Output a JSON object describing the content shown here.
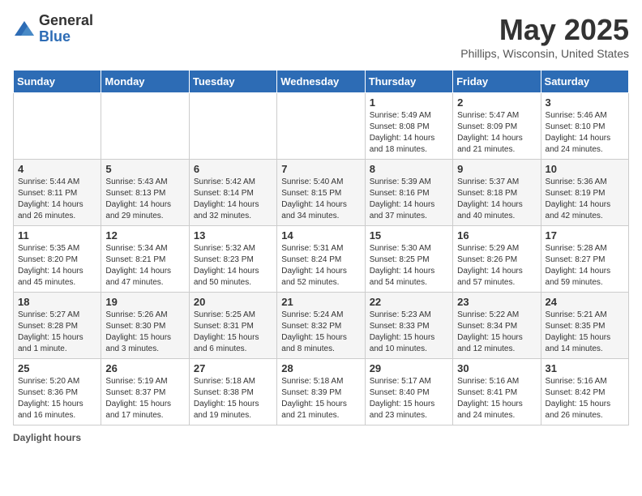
{
  "header": {
    "logo_general": "General",
    "logo_blue": "Blue",
    "month_title": "May 2025",
    "location": "Phillips, Wisconsin, United States"
  },
  "days_of_week": [
    "Sunday",
    "Monday",
    "Tuesday",
    "Wednesday",
    "Thursday",
    "Friday",
    "Saturday"
  ],
  "weeks": [
    [
      {
        "day": "",
        "sunrise": "",
        "sunset": "",
        "daylight": ""
      },
      {
        "day": "",
        "sunrise": "",
        "sunset": "",
        "daylight": ""
      },
      {
        "day": "",
        "sunrise": "",
        "sunset": "",
        "daylight": ""
      },
      {
        "day": "",
        "sunrise": "",
        "sunset": "",
        "daylight": ""
      },
      {
        "day": "1",
        "sunrise": "Sunrise: 5:49 AM",
        "sunset": "Sunset: 8:08 PM",
        "daylight": "Daylight: 14 hours and 18 minutes."
      },
      {
        "day": "2",
        "sunrise": "Sunrise: 5:47 AM",
        "sunset": "Sunset: 8:09 PM",
        "daylight": "Daylight: 14 hours and 21 minutes."
      },
      {
        "day": "3",
        "sunrise": "Sunrise: 5:46 AM",
        "sunset": "Sunset: 8:10 PM",
        "daylight": "Daylight: 14 hours and 24 minutes."
      }
    ],
    [
      {
        "day": "4",
        "sunrise": "Sunrise: 5:44 AM",
        "sunset": "Sunset: 8:11 PM",
        "daylight": "Daylight: 14 hours and 26 minutes."
      },
      {
        "day": "5",
        "sunrise": "Sunrise: 5:43 AM",
        "sunset": "Sunset: 8:13 PM",
        "daylight": "Daylight: 14 hours and 29 minutes."
      },
      {
        "day": "6",
        "sunrise": "Sunrise: 5:42 AM",
        "sunset": "Sunset: 8:14 PM",
        "daylight": "Daylight: 14 hours and 32 minutes."
      },
      {
        "day": "7",
        "sunrise": "Sunrise: 5:40 AM",
        "sunset": "Sunset: 8:15 PM",
        "daylight": "Daylight: 14 hours and 34 minutes."
      },
      {
        "day": "8",
        "sunrise": "Sunrise: 5:39 AM",
        "sunset": "Sunset: 8:16 PM",
        "daylight": "Daylight: 14 hours and 37 minutes."
      },
      {
        "day": "9",
        "sunrise": "Sunrise: 5:37 AM",
        "sunset": "Sunset: 8:18 PM",
        "daylight": "Daylight: 14 hours and 40 minutes."
      },
      {
        "day": "10",
        "sunrise": "Sunrise: 5:36 AM",
        "sunset": "Sunset: 8:19 PM",
        "daylight": "Daylight: 14 hours and 42 minutes."
      }
    ],
    [
      {
        "day": "11",
        "sunrise": "Sunrise: 5:35 AM",
        "sunset": "Sunset: 8:20 PM",
        "daylight": "Daylight: 14 hours and 45 minutes."
      },
      {
        "day": "12",
        "sunrise": "Sunrise: 5:34 AM",
        "sunset": "Sunset: 8:21 PM",
        "daylight": "Daylight: 14 hours and 47 minutes."
      },
      {
        "day": "13",
        "sunrise": "Sunrise: 5:32 AM",
        "sunset": "Sunset: 8:23 PM",
        "daylight": "Daylight: 14 hours and 50 minutes."
      },
      {
        "day": "14",
        "sunrise": "Sunrise: 5:31 AM",
        "sunset": "Sunset: 8:24 PM",
        "daylight": "Daylight: 14 hours and 52 minutes."
      },
      {
        "day": "15",
        "sunrise": "Sunrise: 5:30 AM",
        "sunset": "Sunset: 8:25 PM",
        "daylight": "Daylight: 14 hours and 54 minutes."
      },
      {
        "day": "16",
        "sunrise": "Sunrise: 5:29 AM",
        "sunset": "Sunset: 8:26 PM",
        "daylight": "Daylight: 14 hours and 57 minutes."
      },
      {
        "day": "17",
        "sunrise": "Sunrise: 5:28 AM",
        "sunset": "Sunset: 8:27 PM",
        "daylight": "Daylight: 14 hours and 59 minutes."
      }
    ],
    [
      {
        "day": "18",
        "sunrise": "Sunrise: 5:27 AM",
        "sunset": "Sunset: 8:28 PM",
        "daylight": "Daylight: 15 hours and 1 minute."
      },
      {
        "day": "19",
        "sunrise": "Sunrise: 5:26 AM",
        "sunset": "Sunset: 8:30 PM",
        "daylight": "Daylight: 15 hours and 3 minutes."
      },
      {
        "day": "20",
        "sunrise": "Sunrise: 5:25 AM",
        "sunset": "Sunset: 8:31 PM",
        "daylight": "Daylight: 15 hours and 6 minutes."
      },
      {
        "day": "21",
        "sunrise": "Sunrise: 5:24 AM",
        "sunset": "Sunset: 8:32 PM",
        "daylight": "Daylight: 15 hours and 8 minutes."
      },
      {
        "day": "22",
        "sunrise": "Sunrise: 5:23 AM",
        "sunset": "Sunset: 8:33 PM",
        "daylight": "Daylight: 15 hours and 10 minutes."
      },
      {
        "day": "23",
        "sunrise": "Sunrise: 5:22 AM",
        "sunset": "Sunset: 8:34 PM",
        "daylight": "Daylight: 15 hours and 12 minutes."
      },
      {
        "day": "24",
        "sunrise": "Sunrise: 5:21 AM",
        "sunset": "Sunset: 8:35 PM",
        "daylight": "Daylight: 15 hours and 14 minutes."
      }
    ],
    [
      {
        "day": "25",
        "sunrise": "Sunrise: 5:20 AM",
        "sunset": "Sunset: 8:36 PM",
        "daylight": "Daylight: 15 hours and 16 minutes."
      },
      {
        "day": "26",
        "sunrise": "Sunrise: 5:19 AM",
        "sunset": "Sunset: 8:37 PM",
        "daylight": "Daylight: 15 hours and 17 minutes."
      },
      {
        "day": "27",
        "sunrise": "Sunrise: 5:18 AM",
        "sunset": "Sunset: 8:38 PM",
        "daylight": "Daylight: 15 hours and 19 minutes."
      },
      {
        "day": "28",
        "sunrise": "Sunrise: 5:18 AM",
        "sunset": "Sunset: 8:39 PM",
        "daylight": "Daylight: 15 hours and 21 minutes."
      },
      {
        "day": "29",
        "sunrise": "Sunrise: 5:17 AM",
        "sunset": "Sunset: 8:40 PM",
        "daylight": "Daylight: 15 hours and 23 minutes."
      },
      {
        "day": "30",
        "sunrise": "Sunrise: 5:16 AM",
        "sunset": "Sunset: 8:41 PM",
        "daylight": "Daylight: 15 hours and 24 minutes."
      },
      {
        "day": "31",
        "sunrise": "Sunrise: 5:16 AM",
        "sunset": "Sunset: 8:42 PM",
        "daylight": "Daylight: 15 hours and 26 minutes."
      }
    ]
  ],
  "footer": {
    "label": "Daylight hours"
  }
}
